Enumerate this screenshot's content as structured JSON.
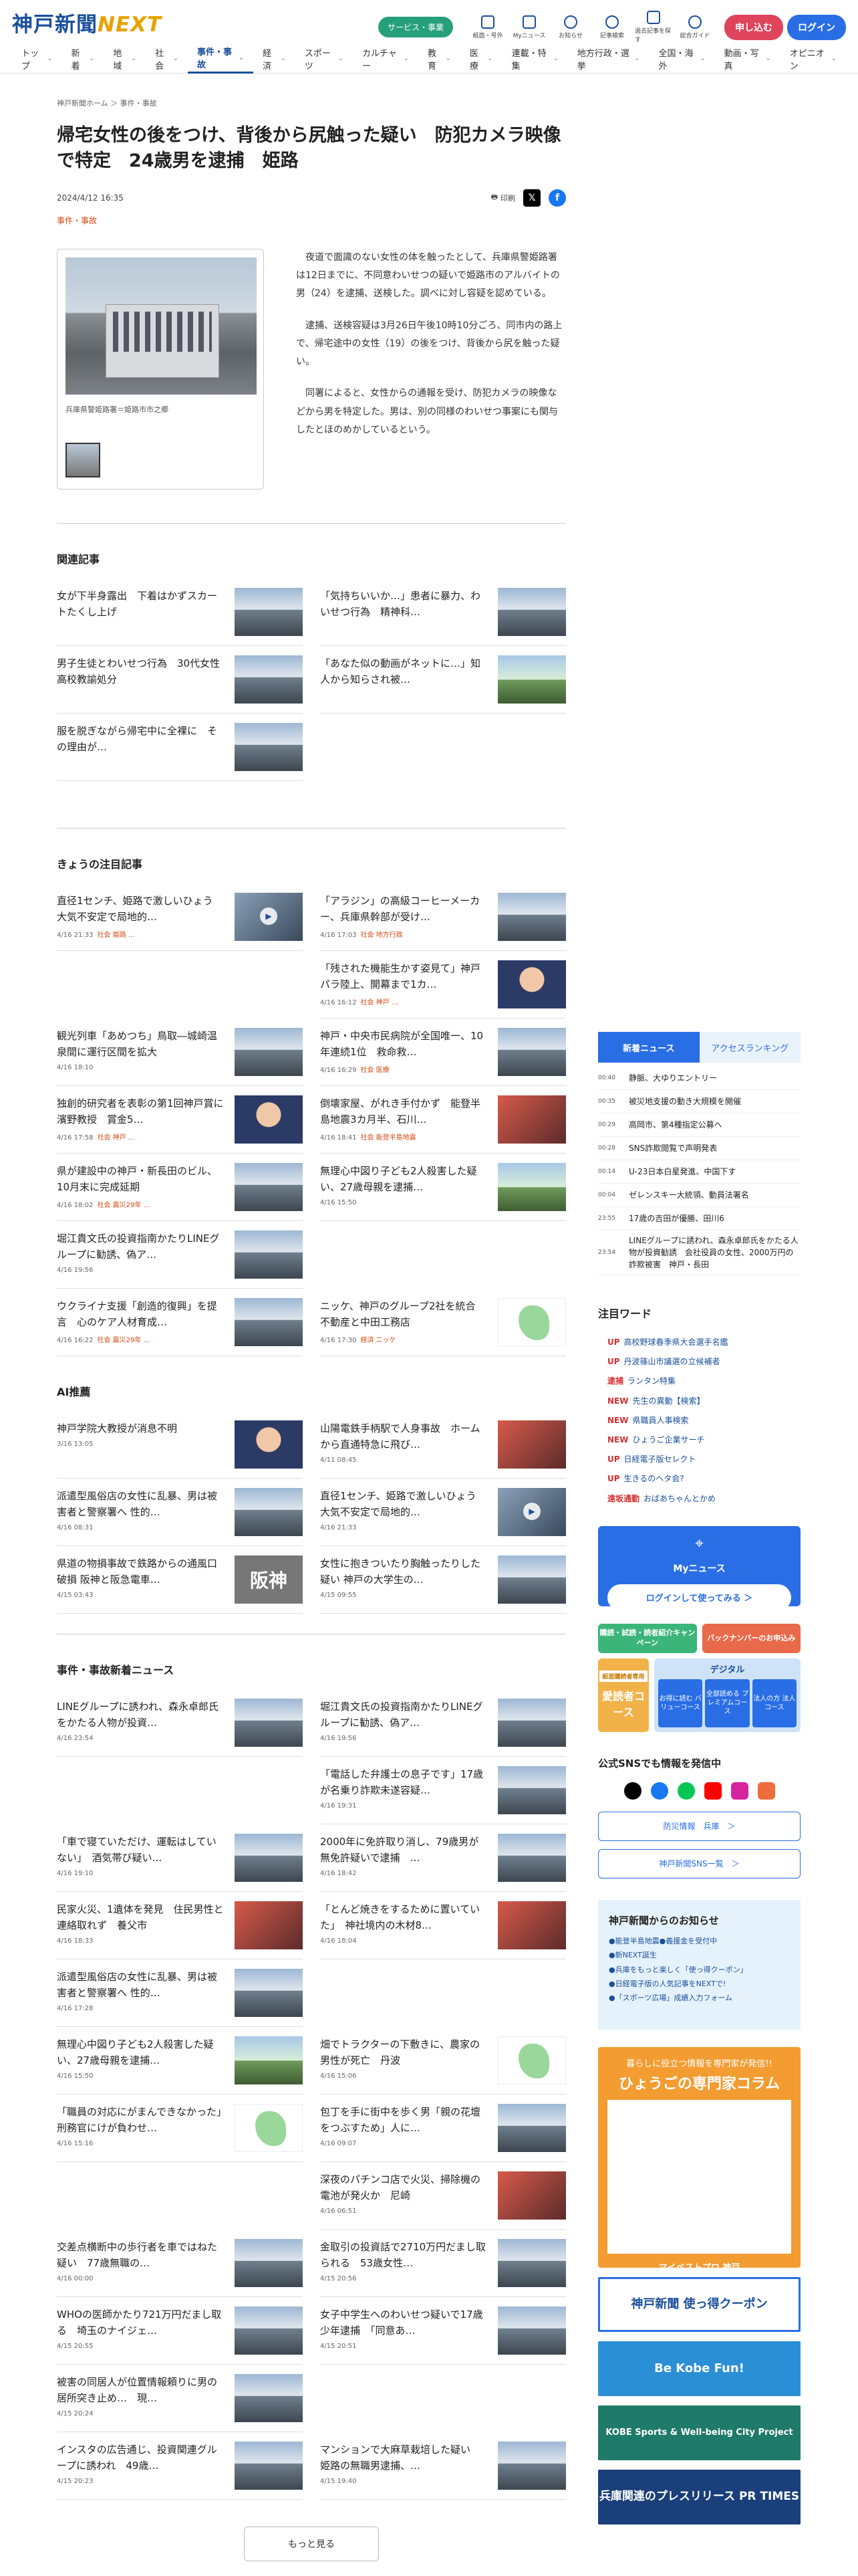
{
  "header": {
    "logo_main": "神戸新聞",
    "logo_sub": "NEXT",
    "services": "サービス・事業",
    "icons": [
      "紙面・号外",
      "Myニュース",
      "お知らせ",
      "記事検索",
      "過去記事を探す",
      "総合ガイド"
    ],
    "subscribe": "申し込む",
    "login": "ログイン"
  },
  "nav": [
    "トップ",
    "新着",
    "地域",
    "社会",
    "事件・事故",
    "経済",
    "スポーツ",
    "カルチャー",
    "教育",
    "医療",
    "連載・特集",
    "地方行政・選挙",
    "全国・海外",
    "動画・写真",
    "オピニオン"
  ],
  "breadcrumb": "神戸新聞ホーム ＞ 事件・事故",
  "article": {
    "title": "帰宅女性の後をつけ、背後から尻触った疑い　防犯カメラ映像で特定　24歳男を逮捕　姫路",
    "date": "2024/4/12 16:35",
    "print": "印刷",
    "category": "事件・事故",
    "caption": "兵庫県警姫路署＝姫路市市之郷",
    "paragraphs": [
      "夜道で面識のない女性の体を触ったとして、兵庫県警姫路署は12日までに、不同意わいせつの疑いで姫路市のアルバイトの男（24）を逮捕、送検した。調べに対し容疑を認めている。",
      "逮捕、送検容疑は3月26日午後10時10分ごろ、同市内の路上で、帰宅途中の女性（19）の後をつけ、背後から尻を触った疑い。",
      "同署によると、女性からの通報を受け、防犯カメラの映像などから男を特定した。男は、別の同様のわいせつ事案にも関与したとほのめかしているという。"
    ]
  },
  "related": {
    "heading": "関連記事",
    "items": [
      {
        "t": "女が下半身露出　下着はかずスカートたくし上げ"
      },
      {
        "t": "「気持ちいいか…」患者に暴力、わいせつ行為　精神科…"
      },
      {
        "t": "男子生徒とわいせつ行為　30代女性高校教諭処分"
      },
      {
        "t": "「あなた似の動画がネットに…」知人から知らされ被…"
      },
      {
        "t": "服を脱ぎながら帰宅中に全裸に　その理由が…"
      }
    ]
  },
  "featured": {
    "heading": "きょうの注目記事",
    "items": [
      {
        "t": "直径1センチ、姫路で激しいひょう　大気不安定で局地的…",
        "m": "4/16 21:33",
        "c": "社会 姫路 …"
      },
      {
        "t": "「アラジン」の高級コーヒーメーカー、兵庫県幹部が受け…",
        "m": "4/16 17:03",
        "c": "社会 地方行政"
      },
      {
        "t": "",
        "m": "",
        "c": ""
      },
      {
        "t": "「残された機能生かす姿見て」神戸パラ陸上、開幕まで1カ…",
        "m": "4/16 16:12",
        "c": "社会 神戸 …"
      },
      {
        "t": "観光列車「あめつち」鳥取―城崎温泉間に運行区間を拡大",
        "m": "4/16 18:10",
        "c": ""
      },
      {
        "t": "神戸・中央市民病院が全国唯一、10年連続1位　救命救…",
        "m": "4/16 16:29",
        "c": "社会 医療"
      },
      {
        "t": "独創的研究者を表彰の第1回神戸賞に濱野教授　賞金5…",
        "m": "4/16 17:58",
        "c": "社会 神戸 …"
      },
      {
        "t": "倒壊家屋、がれき手付かず　能登半島地震3カ月半、石川…",
        "m": "4/16 18:41",
        "c": "社会 能登半島地震"
      },
      {
        "t": "県が建設中の神戸・新長田のビル、10月末に完成延期",
        "m": "4/16 18:02",
        "c": "社会 震災29年 …"
      },
      {
        "t": "無理心中図り子ども2人殺害した疑い、27歳母親を逮捕…",
        "m": "4/16 15:50",
        "c": ""
      },
      {
        "t": "堀江貴文氏の投資指南かたりLINEグループに勧誘、偽ア…",
        "m": "4/16 19:56",
        "c": ""
      },
      {
        "t": "",
        "m": "",
        "c": ""
      },
      {
        "t": "ウクライナ支援「創造的復興」を提言　心のケア人材育成…",
        "m": "4/16 16:22",
        "c": "社会 震災29年 …"
      },
      {
        "t": "ニッケ、神戸のグループ2社を統合　不動産と中田工務店",
        "m": "4/16 17:30",
        "c": "経済 ニッケ"
      }
    ]
  },
  "ai": {
    "heading": "AI推薦",
    "items": [
      {
        "t": "神戸学院大教授が消息不明",
        "m": "3/16 13:05"
      },
      {
        "t": "山陽電鉄手柄駅で人身事故　ホームから直通特急に飛び…",
        "m": "4/11 08:45"
      },
      {
        "t": "派遣型風俗店の女性に乱暴、男は被害者と警察署へ 性的…",
        "m": "4/16 08:31"
      },
      {
        "t": "直径1センチ、姫路で激しいひょう 大気不安定で局地的…",
        "m": "4/16 21:33"
      },
      {
        "t": "県道の物損事故で鉄路からの通風口破損 阪神と阪急電車…",
        "m": "4/15 03:43"
      },
      {
        "t": "女性に抱きついたり胸触ったりした疑い 神戸の大学生の…",
        "m": "4/15 09:55"
      }
    ]
  },
  "latest": {
    "heading": "事件・事故新着ニュース",
    "more": "もっと見る",
    "items": [
      {
        "t": "LINEグループに誘われ、森永卓郎氏をかたる人物が投資…",
        "m": "4/16 23:54"
      },
      {
        "t": "堀江貴文氏の投資指南かたりLINEグループに勧誘、偽ア…",
        "m": "4/16 19:56"
      },
      {
        "t": "",
        "m": ""
      },
      {
        "t": "「電話した弁護士の息子です」17歳が名乗り詐欺未遂容疑…",
        "m": "4/16 19:31"
      },
      {
        "t": "「車で寝ていただけ、運転はしていない」　酒気帯び疑い…",
        "m": "4/16 19:10"
      },
      {
        "t": "2000年に免許取り消し、79歳男が無免許疑いで逮捕　…",
        "m": "4/16 18:42"
      },
      {
        "t": "民家火災、1遺体を発見　住民男性と連絡取れず　養父市",
        "m": "4/16 18:33"
      },
      {
        "t": "「とんど焼きをするために置いていた」　神社境内の木材8…",
        "m": "4/16 18:04"
      },
      {
        "t": "派遣型風俗店の女性に乱暴、男は被害者と警察署へ 性的…",
        "m": "4/16 17:28"
      },
      {
        "t": "",
        "m": ""
      },
      {
        "t": "無理心中図り子ども2人殺害した疑い、27歳母親を逮捕…",
        "m": "4/16 15:50"
      },
      {
        "t": "畑でトラクターの下敷きに、農家の男性が死亡　丹波",
        "m": "4/16 15:06"
      },
      {
        "t": "「職員の対応にがまんできなかった」刑務官にけが負わせ…",
        "m": "4/16 15:16"
      },
      {
        "t": "包丁を手に街中を歩く男「親の花壇をつぶすため」人に…",
        "m": "4/16 09:07"
      },
      {
        "t": "",
        "m": ""
      },
      {
        "t": "深夜のパチンコ店で火災、掃除機の電池が発火か　尼崎",
        "m": "4/16 06:51"
      },
      {
        "t": "交差点横断中の歩行者を車ではねた疑い　77歳無職の…",
        "m": "4/16 00:00"
      },
      {
        "t": "金取引の投資話で2710万円だまし取られる　53歳女性…",
        "m": "4/15 20:56"
      },
      {
        "t": "WHOの医師かたり721万円だまし取る　埼玉のナイジェ…",
        "m": "4/15 20:55"
      },
      {
        "t": "女子中学生へのわいせつ疑いで17歳少年逮捕　「同意あ…",
        "m": "4/15 20:51"
      },
      {
        "t": "被害の同居人が位置情報頼りに男の居所突き止め…　現…",
        "m": "4/15 20:24"
      },
      {
        "t": "",
        "m": ""
      },
      {
        "t": "インスタの広告通じ、投資関連グループに誘われ　49歳…",
        "m": "4/15 20:23"
      },
      {
        "t": "マンションで大麻草栽培した疑い　姫路の無職男逮捕、…",
        "m": "4/15 19:40"
      }
    ]
  },
  "side": {
    "tab_new": "新着ニュース",
    "tab_rank": "アクセスランキング",
    "ranking": [
      {
        "tm": "00:40",
        "tx": "静脈、大ゆりエントリー"
      },
      {
        "tm": "00:35",
        "tx": "被災地支援の動き大規模を開催"
      },
      {
        "tm": "00:29",
        "tx": "高岡市、第4種指定公募へ"
      },
      {
        "tm": "00:28",
        "tx": "SNS詐欺閲覧で声明発表"
      },
      {
        "tm": "00:14",
        "tx": "U-23日本白星発進、中国下す"
      },
      {
        "tm": "00:04",
        "tx": "ゼレンスキー大統領、動員法署名"
      },
      {
        "tm": "23:55",
        "tx": "17歳の吉田が優勝、田川6"
      },
      {
        "tm": "23:54",
        "tx": "LINEグループに誘われ、森永卓郎氏をかたる人物が投資勧誘　会社役員の女性、2000万円の詐欺被害　神戸・長田"
      }
    ],
    "kw_heading": "注目ワード",
    "keywords": [
      {
        "tg": "UP",
        "cls": "up",
        "k": "高校野球春季県大会選手名鑑"
      },
      {
        "tg": "UP",
        "cls": "up",
        "k": "丹波篠山市議選の立候補者"
      },
      {
        "tg": "逮捕",
        "cls": "arrest",
        "k": "ランタン特集"
      },
      {
        "tg": "NEW",
        "cls": "new",
        "k": "先生の異動【検索】"
      },
      {
        "tg": "NEW",
        "cls": "new",
        "k": "県職員人事検索"
      },
      {
        "tg": "NEW",
        "cls": "new",
        "k": "ひょうご企業サーチ"
      },
      {
        "tg": "UP",
        "cls": "up",
        "k": "日経電子版セレクト"
      },
      {
        "tg": "UP",
        "cls": "up",
        "k": "生きるのヘタ会?"
      },
      {
        "tg": "遠坂通勤",
        "cls": "arrest",
        "k": "おばあちゃんとかめ"
      }
    ],
    "mynews_title": "Myニュース",
    "mynews_btn": "ログインして使ってみる ＞",
    "promo1": "購読・試読・読者紹介キャンペーン",
    "promo2": "バックナンバーのお申込み",
    "sub_label": "紙面購読者専用",
    "sub_main": "愛読者コース",
    "digital": "デジタル",
    "digital_opts": [
      "お得に読む バリューコース",
      "全部読める プレミアムコース",
      "法人の方 法人コース"
    ],
    "sns_heading": "公式SNSでも情報を発信中",
    "link1": "防災情報　兵庫　＞",
    "link2": "神戸新聞SNS一覧　＞",
    "notice_heading": "神戸新聞からのお知らせ",
    "notices": [
      "●能登半島地震●義援金を受付中",
      "●新NEXT誕生",
      "●兵庫をもっと楽しく「使っ得クーポン」",
      "●日経電子版の人気記事をNEXTで!",
      "●「スポーツ広場」成績入力フォーム"
    ],
    "banner_top": "暮らしに役立つ情報を専門家が発信!!",
    "banner_title": "ひょうごの専門家コラム",
    "banner_foot": "マイベストプロ 神戸",
    "ads": [
      "神戸新聞 使っ得クーポン",
      "Be Kobe Fun!",
      "KOBE Sports & Well-being City Project",
      "兵庫関連のプレスリリース PR TIMES"
    ]
  },
  "colors": {
    "brand": "#1a4f9c",
    "accent": "#2a6ee6",
    "category": "#d44a14"
  }
}
